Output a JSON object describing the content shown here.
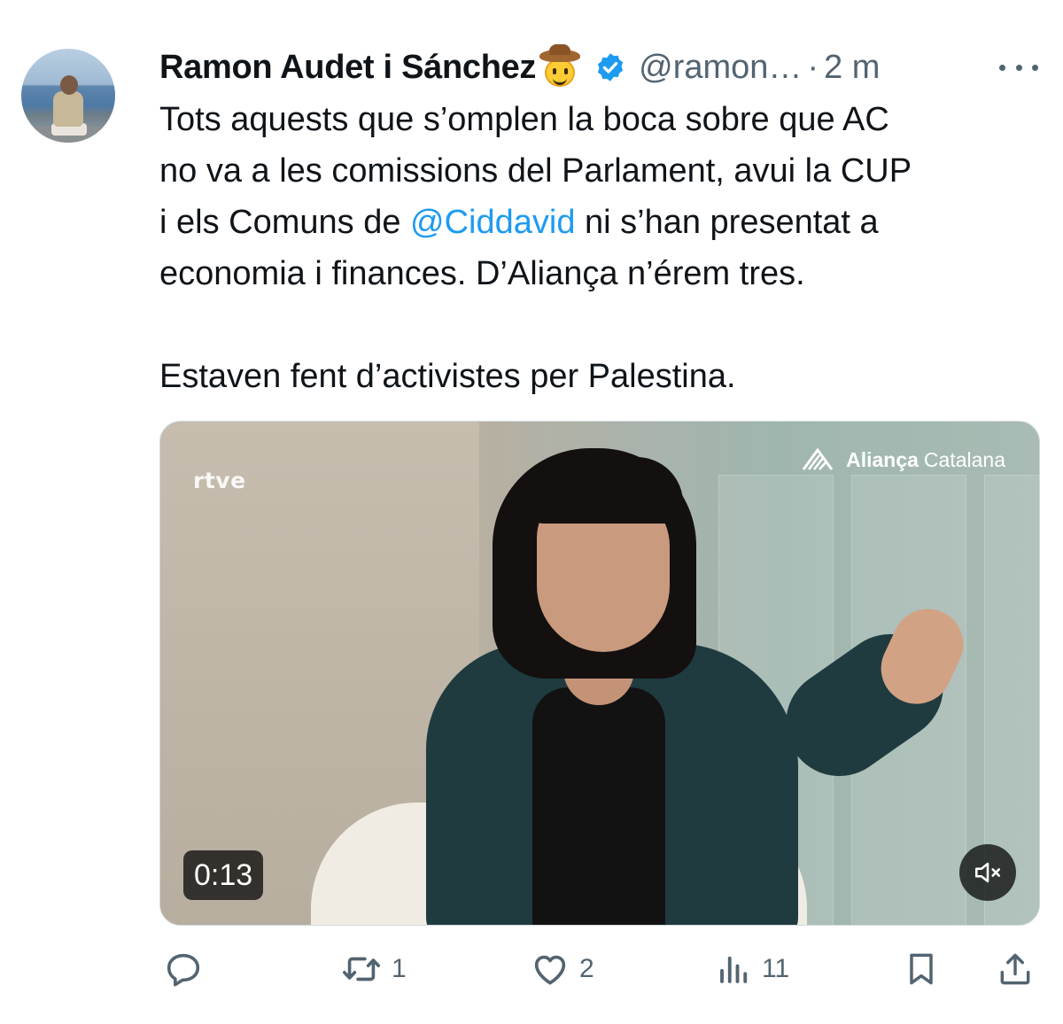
{
  "author": {
    "name": "Ramon Audet i Sánchez",
    "emoji": "cowboy-hat-face",
    "verified": true,
    "handle": "@ramon…",
    "separator": "·",
    "time": "2 m"
  },
  "tweet": {
    "lines": [
      "Tots aquests que s’omplen la boca sobre que AC",
      "no va a les comissions del Parlament, avui la CUP"
    ],
    "line3_prefix": "i els Comuns de ",
    "mention": "@Ciddavid",
    "line3_suffix": " ni s’han presentat a",
    "line4": "economia i finances. D’Aliança n’érem tres.",
    "paragraph2": "Estaven fent d’activistes per Palestina."
  },
  "media": {
    "watermark_left": "rtve",
    "brand_bold": "Aliança",
    "brand_regular": "Catalana",
    "duration": "0:13",
    "muted": true
  },
  "actions": {
    "reply_count": "",
    "retweet_count": "1",
    "like_count": "2",
    "views_count": "11"
  },
  "colors": {
    "text": "#0f1419",
    "secondary": "#536471",
    "link": "#1d9bf0",
    "verified": "#1d9bf0"
  },
  "icons": [
    "more-icon",
    "verified-badge-icon",
    "reply-icon",
    "retweet-icon",
    "like-icon",
    "views-icon",
    "bookmark-icon",
    "share-icon",
    "mute-icon"
  ]
}
